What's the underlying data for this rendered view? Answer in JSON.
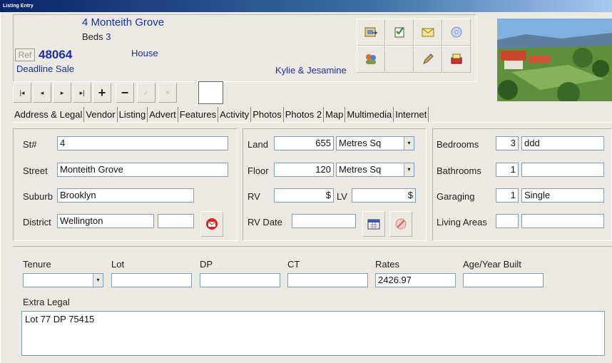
{
  "window": {
    "title": "Listing Entry"
  },
  "header": {
    "address": "4 Monteith Grove",
    "beds_label": "Beds",
    "beds_value": "3",
    "ref_label": "Ref",
    "ref_number": "48064",
    "property_type": "House",
    "sale_method": "Deadline Sale",
    "agents": "Kylie & Jesamine"
  },
  "nav": {
    "first": "|◂",
    "prev": "◂",
    "next": "▸",
    "last": "▸|",
    "add": "+",
    "delete": "−",
    "confirm": "✓",
    "cancel": "✕"
  },
  "tabs": [
    "Address & Legal",
    "Vendor",
    "Listing",
    "Advert",
    "Features",
    "Activity",
    "Photos",
    "Photos 2",
    "Map",
    "Multimedia",
    "Internet"
  ],
  "address_panel": {
    "st_label": "St#",
    "st_value": "4",
    "street_label": "Street",
    "street_value": "Monteith Grove",
    "suburb_label": "Suburb",
    "suburb_value": "Brooklyn",
    "district_label": "District",
    "district_value": "Wellington",
    "district_extra": ""
  },
  "land_panel": {
    "land_label": "Land",
    "land_value": "655",
    "land_unit": "Metres Sq",
    "floor_label": "Floor",
    "floor_value": "120",
    "floor_unit": "Metres Sq",
    "rv_label": "RV",
    "rv_value": "$",
    "lv_label": "LV",
    "lv_value": "$",
    "rv_date_label": "RV Date",
    "rv_date_value": ""
  },
  "rooms_panel": {
    "bedrooms_label": "Bedrooms",
    "bedrooms_value": "3",
    "bedrooms_note": "ddd",
    "bathrooms_label": "Bathrooms",
    "bathrooms_value": "1",
    "bathrooms_note": "",
    "garaging_label": "Garaging",
    "garaging_value": "1",
    "garaging_note": "Single",
    "living_label": "Living Areas",
    "living_value": "",
    "living_note": ""
  },
  "legal": {
    "tenure_label": "Tenure",
    "tenure_value": "",
    "lot_label": "Lot",
    "lot_value": "",
    "dp_label": "DP",
    "dp_value": "",
    "ct_label": "CT",
    "ct_value": "",
    "rates_label": "Rates",
    "rates_value": "2426.97",
    "age_label": "Age/Year Built",
    "age_value": "",
    "extra_label": "Extra Legal",
    "extra_value": "Lot 77 DP 75415"
  },
  "colors": {
    "accent_blue": "#1b2fa6",
    "background": "#ece9e2",
    "titlebar": "#0a246a"
  },
  "icons": [
    "import-icon",
    "notepad-icon",
    "email-icon",
    "disc-icon",
    "people-icon",
    "pencil-icon",
    "printer-icon",
    "calendar-icon",
    "clear-icon",
    "mail-red-icon"
  ]
}
